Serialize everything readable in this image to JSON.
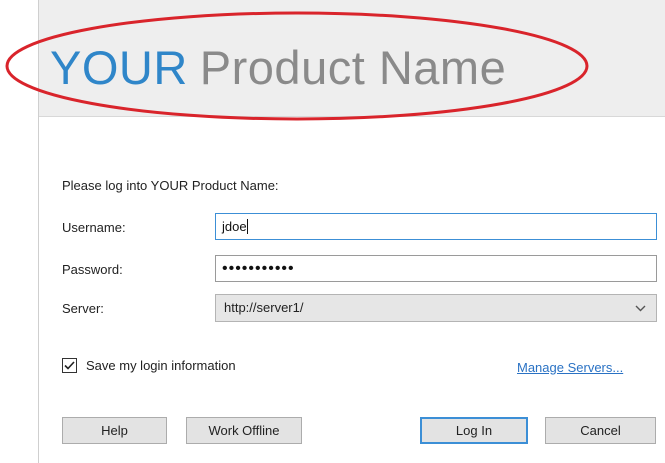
{
  "header": {
    "brand_your": "YOUR",
    "brand_product": "Product Name"
  },
  "form": {
    "prompt": "Please log into YOUR Product Name:",
    "username_label": "Username:",
    "username_value": "jdoe",
    "password_label": "Password:",
    "password_mask": "•••••••••••",
    "server_label": "Server:",
    "server_value": "http://server1/",
    "save_login_label": "Save my login information",
    "save_login_checked": true,
    "manage_servers_link": "Manage Servers..."
  },
  "buttons": {
    "help": "Help",
    "work_offline": "Work Offline",
    "log_in": "Log In",
    "cancel": "Cancel"
  },
  "colors": {
    "brand_blue": "#2f86c9",
    "annotation_red": "#d9242b",
    "focus_blue": "#3c8fd6",
    "link_blue": "#2a72c4"
  },
  "icons": {
    "select_arrow": "chevron-down-icon",
    "checkbox": "check-icon"
  }
}
